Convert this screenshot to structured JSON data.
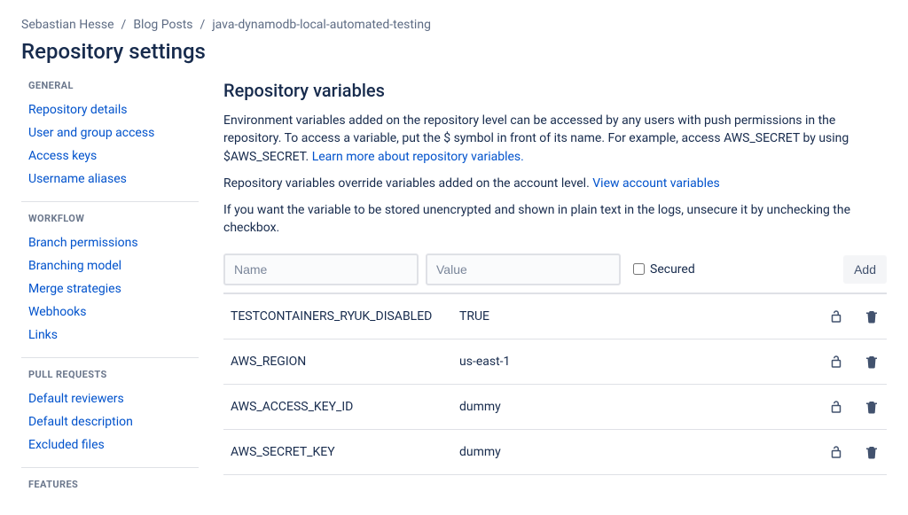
{
  "breadcrumb": {
    "items": [
      "Sebastian Hesse",
      "Blog Posts",
      "java-dynamodb-local-automated-testing"
    ]
  },
  "page_title": "Repository settings",
  "sidebar": {
    "sections": [
      {
        "title": "GENERAL",
        "items": [
          "Repository details",
          "User and group access",
          "Access keys",
          "Username aliases"
        ]
      },
      {
        "title": "WORKFLOW",
        "items": [
          "Branch permissions",
          "Branching model",
          "Merge strategies",
          "Webhooks",
          "Links"
        ]
      },
      {
        "title": "PULL REQUESTS",
        "items": [
          "Default reviewers",
          "Default description",
          "Excluded files"
        ]
      },
      {
        "title": "FEATURES",
        "items": []
      }
    ]
  },
  "main": {
    "heading": "Repository variables",
    "desc1_a": "Environment variables added on the repository level can be accessed by any users with push permissions in the repository. To access a variable, put the $ symbol in front of its name. For example, access AWS_SECRET by using $AWS_SECRET. ",
    "desc1_link": "Learn more about repository variables.",
    "desc2_a": "Repository variables override variables added on the account level. ",
    "desc2_link": "View account variables",
    "desc3": "If you want the variable to be stored unencrypted and shown in plain text in the logs, unsecure it by unchecking the checkbox.",
    "form": {
      "name_placeholder": "Name",
      "value_placeholder": "Value",
      "secured_label": "Secured",
      "add_label": "Add"
    },
    "variables": [
      {
        "name": "TESTCONTAINERS_RYUK_DISABLED",
        "value": "TRUE"
      },
      {
        "name": "AWS_REGION",
        "value": "us-east-1"
      },
      {
        "name": "AWS_ACCESS_KEY_ID",
        "value": "dummy"
      },
      {
        "name": "AWS_SECRET_KEY",
        "value": "dummy"
      }
    ]
  }
}
